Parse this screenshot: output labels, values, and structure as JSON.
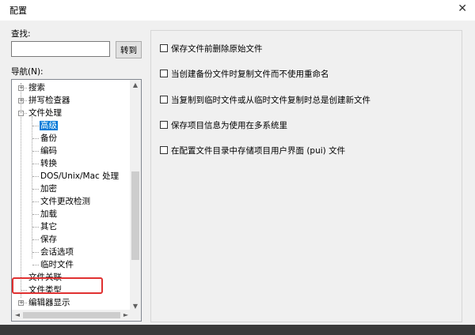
{
  "window": {
    "title": "配置",
    "close": "✕"
  },
  "search": {
    "label": "查找:",
    "value": "",
    "placeholder": "",
    "button": "转到"
  },
  "nav": {
    "label": "导航(N):",
    "items": [
      {
        "label": "搜索",
        "expander": "+"
      },
      {
        "label": "拼写检查器",
        "expander": "+"
      },
      {
        "label": "文件处理",
        "expander": "-"
      },
      {
        "label": "高级",
        "selected": true
      },
      {
        "label": "备份"
      },
      {
        "label": "编码"
      },
      {
        "label": "转换"
      },
      {
        "label": "DOS/Unix/Mac 处理"
      },
      {
        "label": "加密"
      },
      {
        "label": "文件更改检测"
      },
      {
        "label": "加载"
      },
      {
        "label": "其它"
      },
      {
        "label": "保存"
      },
      {
        "label": "会话选项",
        "highlighted": true
      },
      {
        "label": "临时文件"
      },
      {
        "label": "文件关联"
      },
      {
        "label": "文件类型"
      },
      {
        "label": "编辑器显示",
        "expander": "+"
      }
    ]
  },
  "options": [
    {
      "label": "保存文件前删除原始文件",
      "checked": false
    },
    {
      "label": "当创建备份文件时复制文件而不使用重命名",
      "checked": false
    },
    {
      "label": "当复制到临时文件或从临时文件复制时总是创建新文件",
      "checked": false
    },
    {
      "label": "保存项目信息为使用在多系统里",
      "checked": false
    },
    {
      "label": "在配置文件目录中存储项目用户界面 (pui) 文件",
      "checked": false
    }
  ],
  "colors": {
    "selection": "#0078d7",
    "annotation": "#e03131"
  },
  "icons": {
    "close": "close-icon",
    "scroll_up": "▲",
    "scroll_down": "▼",
    "scroll_left": "◄",
    "scroll_right": "►"
  }
}
